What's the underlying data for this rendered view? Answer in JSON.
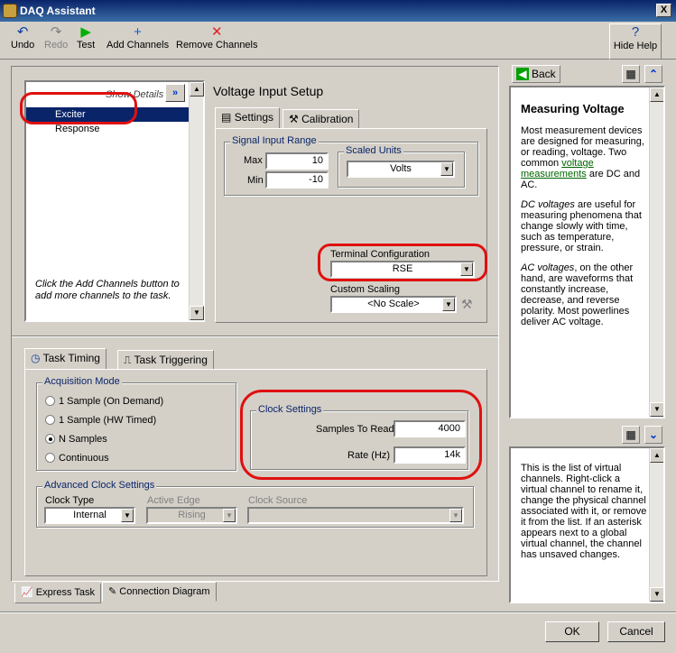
{
  "window": {
    "title": "DAQ Assistant",
    "close": "X"
  },
  "toolbar": {
    "undo": "Undo",
    "redo": "Redo",
    "test": "Test",
    "add_channels": "Add Channels",
    "remove_channels": "Remove Channels",
    "hide_help": "Hide Help"
  },
  "channels": {
    "show_details": "Show Details",
    "items": [
      "Exciter",
      "Response"
    ],
    "selected": "Exciter",
    "hint": "Click the Add Channels button to add more channels to the task."
  },
  "setup": {
    "title": "Voltage Input Setup",
    "tabs": [
      "Settings",
      "Calibration"
    ],
    "signal_range_label": "Signal Input Range",
    "max_label": "Max",
    "max_value": "10",
    "min_label": "Min",
    "min_value": "-10",
    "scaled_units_label": "Scaled Units",
    "scaled_units_value": "Volts",
    "terminal_config_label": "Terminal Configuration",
    "terminal_config_value": "RSE",
    "custom_scaling_label": "Custom Scaling",
    "custom_scaling_value": "<No Scale>"
  },
  "timing": {
    "tabs": [
      "Task Timing",
      "Task Triggering"
    ],
    "acq_mode_label": "Acquisition Mode",
    "modes": [
      "1 Sample (On Demand)",
      "1 Sample (HW Timed)",
      "N Samples",
      "Continuous"
    ],
    "selected_mode": "N Samples",
    "clock_settings_label": "Clock Settings",
    "samples_to_read_label": "Samples To Read",
    "samples_to_read": "4000",
    "rate_label": "Rate (Hz)",
    "rate": "14k",
    "advanced_label": "Advanced Clock Settings",
    "clock_type_label": "Clock Type",
    "clock_type": "Internal",
    "active_edge_label": "Active Edge",
    "active_edge": "Rising",
    "clock_source_label": "Clock Source",
    "clock_source": ""
  },
  "bottom_tabs": [
    "Express Task",
    "Connection Diagram"
  ],
  "help": {
    "back": "Back",
    "heading": "Measuring Voltage",
    "p1_a": "Most measurement devices are designed for measuring, or reading, voltage. Two common ",
    "p1_link": "voltage measurements",
    "p1_b": " are DC and AC.",
    "p2_em": "DC voltages",
    "p2": " are useful for measuring phenomena that change slowly with time, such as temperature, pressure, or strain.",
    "p3_em": "AC voltages",
    "p3": ", on the other hand, are waveforms that constantly increase, decrease, and reverse polarity. Most powerlines deliver AC voltage.",
    "lower": "This is the list of virtual channels. Right-click a virtual channel to rename it, change the physical channel associated with it, or remove it from the list. If an asterisk appears next to a global virtual channel, the channel has unsaved changes."
  },
  "footer": {
    "ok": "OK",
    "cancel": "Cancel"
  },
  "colors": {
    "title_bar": "#0a246a",
    "selection": "#0a246a",
    "highlight_ring": "#e01010",
    "link": "#006400"
  }
}
